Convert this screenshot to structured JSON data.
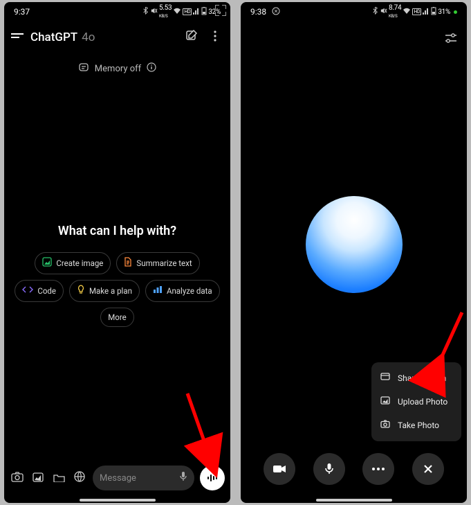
{
  "left": {
    "status": {
      "time": "9:37",
      "net_kbs": "5.53",
      "net_unit": "KB/S",
      "battery": "32%"
    },
    "header": {
      "title": "ChatGPT",
      "model": "4o"
    },
    "memory": {
      "label": "Memory off"
    },
    "prompt": "What can I help with?",
    "chips": {
      "create_image": "Create image",
      "summarize": "Summarize text",
      "code": "Code",
      "plan": "Make a plan",
      "analyze": "Analyze data",
      "more": "More"
    },
    "input": {
      "placeholder": "Message"
    }
  },
  "right": {
    "status": {
      "time": "9:38",
      "net_kbs": "8.74",
      "net_unit": "KB/S",
      "battery": "31%"
    },
    "menu": {
      "share": "Share Screen",
      "upload": "Upload Photo",
      "take": "Take Photo"
    }
  }
}
